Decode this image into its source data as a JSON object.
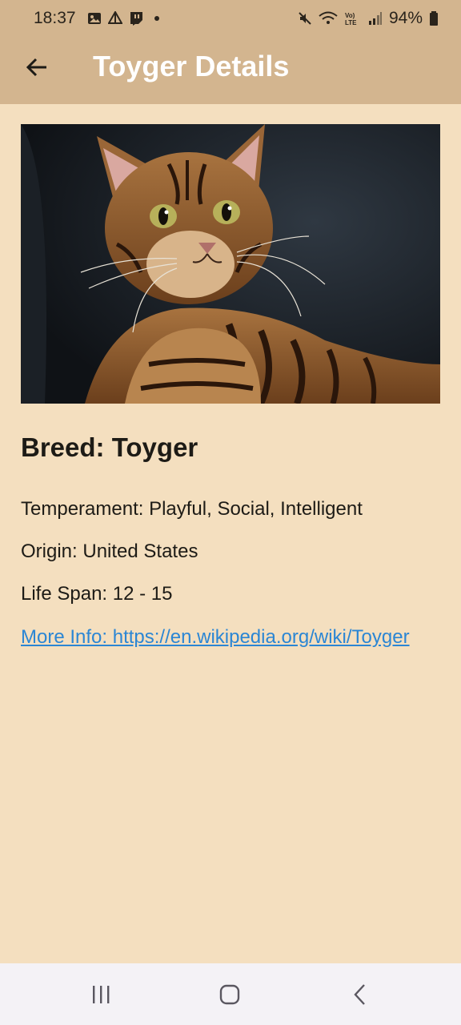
{
  "status_bar": {
    "time": "18:37",
    "notification_icons": [
      "gallery-icon",
      "drive-icon",
      "twitch-icon",
      "dot-icon"
    ],
    "system_icons": [
      "mute-icon",
      "wifi-icon",
      "volte-icon",
      "signal-icon"
    ],
    "volte_label": "VoLTE",
    "battery_percent": "94%"
  },
  "app_bar": {
    "title": "Toyger Details",
    "back_icon": "arrow-left-icon"
  },
  "cat": {
    "breed_heading": "Breed: Toyger",
    "temperament": "Temperament: Playful, Social, Intelligent",
    "origin": "Origin: United States",
    "life_span": "Life Span: 12 - 15",
    "more_info": "More Info: https://en.wikipedia.org/wiki/Toyger"
  },
  "nav_bar": {
    "recents_icon": "recents-icon",
    "home_icon": "home-icon",
    "back_icon": "back-chevron-icon"
  },
  "colors": {
    "background": "#f4dfbf",
    "app_bar": "#d3b58f",
    "title_text": "#ffffff",
    "link": "#2b86d4",
    "nav_bar": "#f4f2f6"
  }
}
